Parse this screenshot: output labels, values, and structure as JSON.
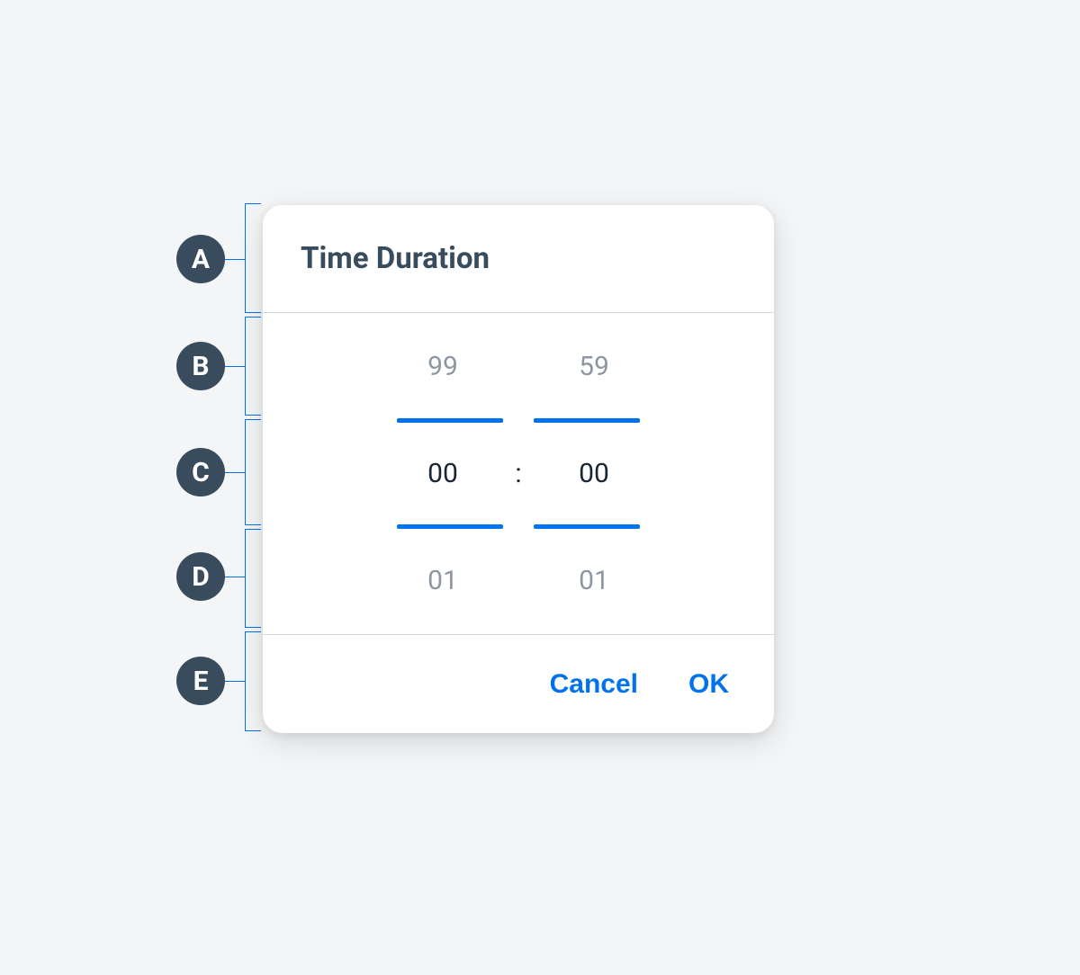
{
  "modal": {
    "title": "Time Duration",
    "hours": {
      "prev": "99",
      "current": "00",
      "next": "01"
    },
    "minutes": {
      "prev": "59",
      "current": "00",
      "next": "01"
    },
    "separator": ":",
    "footer": {
      "cancel": "Cancel",
      "ok": "OK"
    }
  },
  "annotations": {
    "a": "A",
    "b": "B",
    "c": "C",
    "d": "D",
    "e": "E"
  },
  "colors": {
    "accent": "#0072ed",
    "badge_bg": "#394c5e",
    "muted_text": "#8e97a1",
    "dark_text": "#1a2735"
  }
}
